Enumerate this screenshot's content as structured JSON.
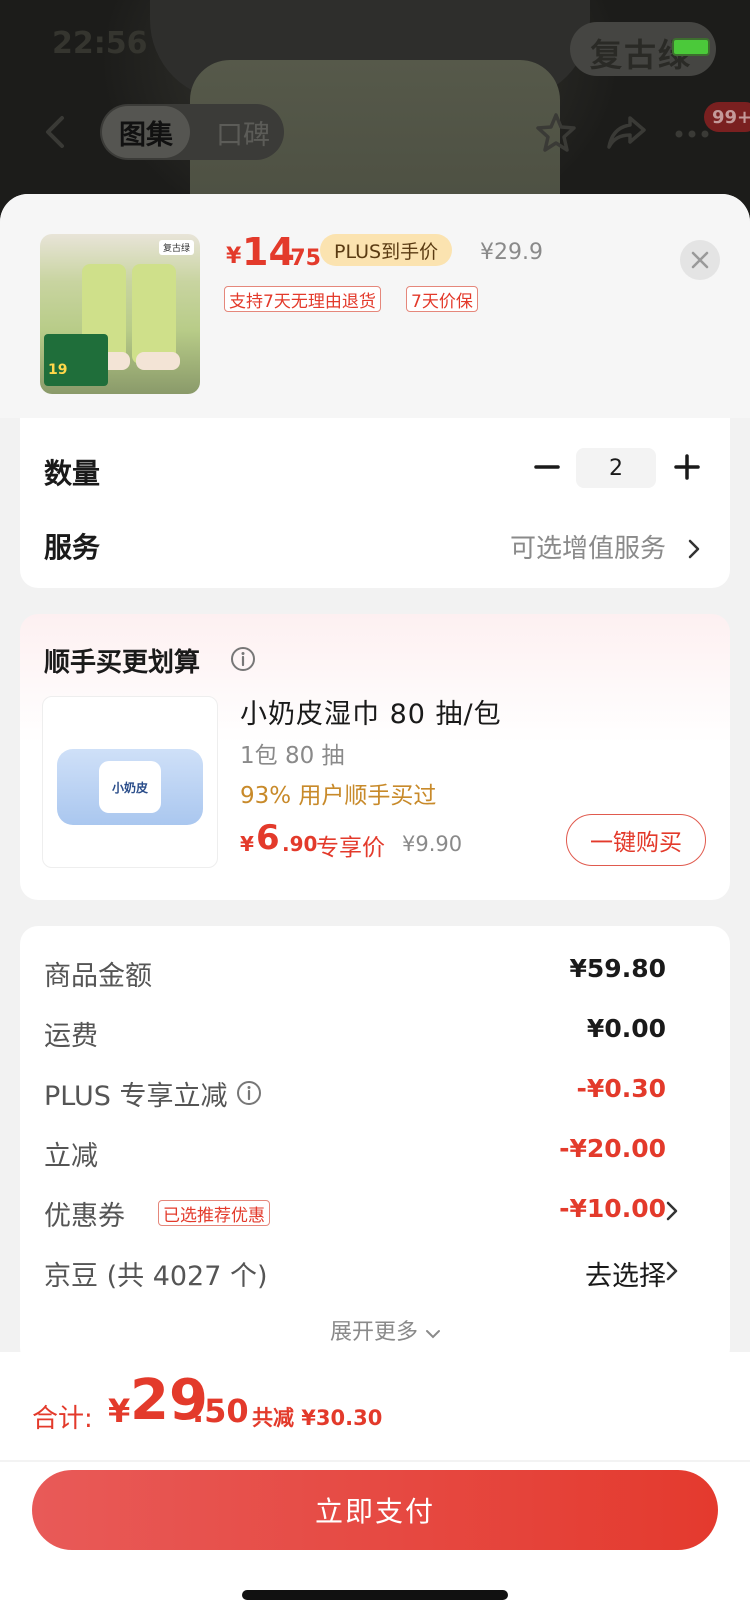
{
  "status_bar": {
    "time": "22:56",
    "pill_text": "复古绿"
  },
  "nav": {
    "tabs": [
      {
        "label": "图集",
        "active": true
      },
      {
        "label": "口碑",
        "active": false
      }
    ],
    "badge": "99+",
    "icons": [
      "back-icon",
      "star-icon",
      "share-icon",
      "more-icon"
    ]
  },
  "product": {
    "thumb_tag": "复古绿",
    "thumb_promo_price": "19",
    "price_currency": "¥",
    "price_integer": "14",
    "price_decimal": ".75",
    "plus_badge": "PLUS到手价",
    "original_price": "¥29.9",
    "tags": [
      "支持7天无理由退货",
      "7天价保"
    ]
  },
  "quantity": {
    "label": "数量",
    "value": "2"
  },
  "service": {
    "label": "服务",
    "value": "可选增值服务"
  },
  "addon": {
    "title": "顺手买更划算",
    "name": "小奶皮湿巾 80 抽/包",
    "spec": "1包 80 抽",
    "rate": "93% 用户顺手买过",
    "price_currency": "¥",
    "price_integer": "6",
    "price_decimal": ".90",
    "exclusive": "专享价",
    "original_price": "¥9.90",
    "buy_label": "一键购买",
    "image_label": "小奶皮"
  },
  "fees": [
    {
      "label": "商品金额",
      "value": "¥59.80",
      "type": "normal"
    },
    {
      "label": "运费",
      "value": "¥0.00",
      "type": "normal"
    },
    {
      "label": "PLUS 专享立减",
      "value": "-¥0.30",
      "type": "neg",
      "info": true
    },
    {
      "label": "立减",
      "value": "-¥20.00",
      "type": "neg"
    },
    {
      "label": "优惠券",
      "value": "-¥10.00",
      "type": "neg",
      "tag": "已选推荐优惠",
      "chevron": true
    },
    {
      "label": "京豆 (共 4027 个)",
      "value": "去选择",
      "type": "plain",
      "chevron": true
    }
  ],
  "expand_more": "展开更多",
  "total": {
    "label": "合计:",
    "currency": "¥",
    "integer": "29",
    "decimal": ".50",
    "saved": "共减 ¥30.30"
  },
  "pay_button": "立即支付",
  "colors": {
    "accent": "#e33a2b",
    "plus_badge_bg": "#fbe3b0",
    "addon_rate": "#c88a2a"
  }
}
